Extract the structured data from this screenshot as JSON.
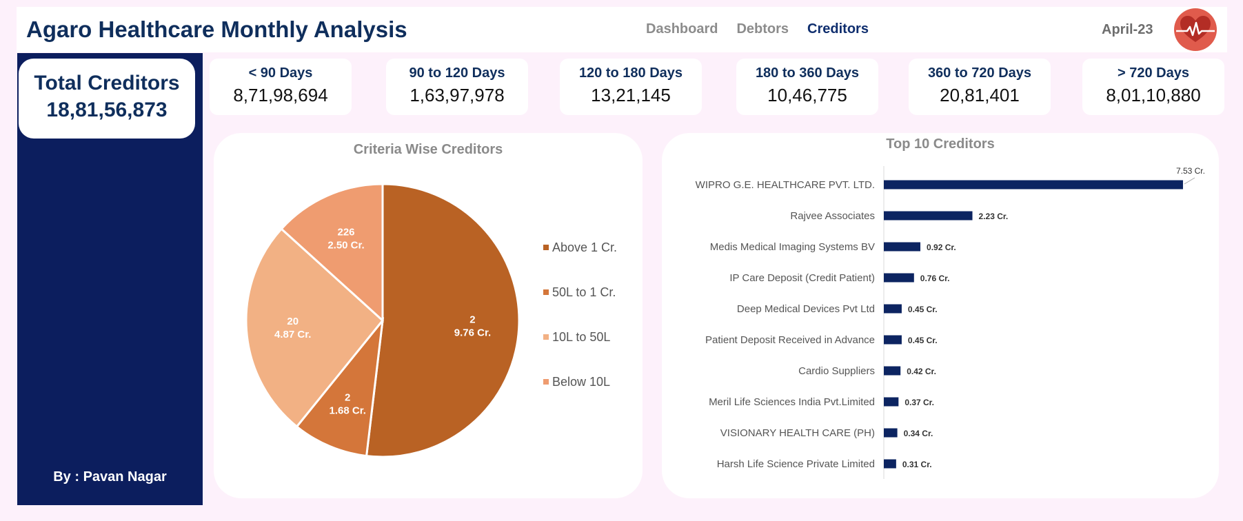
{
  "header": {
    "title": "Agaro Healthcare Monthly Analysis",
    "nav": [
      {
        "label": "Dashboard",
        "active": false
      },
      {
        "label": "Debtors",
        "active": false
      },
      {
        "label": "Creditors",
        "active": true
      }
    ],
    "period": "April-23",
    "logo_icon": "heart-pulse-icon"
  },
  "sidebar": {
    "total_label": "Total Creditors",
    "total_value": "18,81,56,873",
    "author": "By : Pavan Nagar"
  },
  "kpis": [
    {
      "label": "< 90 Days",
      "value": "8,71,98,694"
    },
    {
      "label": "90 to 120 Days",
      "value": "1,63,97,978"
    },
    {
      "label": "120 to 180 Days",
      "value": "13,21,145"
    },
    {
      "label": "180 to 360 Days",
      "value": "10,46,775"
    },
    {
      "label": "360 to 720 Days",
      "value": "20,81,401"
    },
    {
      "label": "> 720 Days",
      "value": "8,01,10,880"
    }
  ],
  "colors": {
    "navy": "#0c1e5e",
    "title_navy": "#0f2e5c",
    "bar": "#0c2461",
    "background": "#fdf1fb"
  },
  "chart_data": [
    {
      "type": "pie",
      "title": "Criteria Wise Creditors",
      "legend_position": "right",
      "slices": [
        {
          "name": "Above 1 Cr.",
          "count": "2",
          "amount": "9.76 Cr.",
          "value": 9.76,
          "color": "#b96224"
        },
        {
          "name": "50L to 1 Cr.",
          "count": "2",
          "amount": "1.68 Cr.",
          "value": 1.68,
          "color": "#d4763a"
        },
        {
          "name": "10L to 50L",
          "count": "20",
          "amount": "4.87 Cr.",
          "value": 4.87,
          "color": "#f2b184"
        },
        {
          "name": "Below 10L",
          "count": "226",
          "amount": "2.50 Cr.",
          "value": 2.5,
          "color": "#ef9c70"
        }
      ]
    },
    {
      "type": "bar",
      "orientation": "horizontal",
      "title": "Top 10 Creditors",
      "categories": [
        "WIPRO G.E. HEALTHCARE PVT. LTD.",
        "Rajvee Associates",
        "Medis Medical Imaging Systems BV",
        "IP Care Deposit (Credit Patient)",
        "Deep Medical Devices Pvt Ltd",
        "Patient Deposit Received in Advance",
        "Cardio Suppliers",
        "Meril Life Sciences India Pvt.Limited",
        "VISIONARY HEALTH CARE  (PH)",
        "Harsh Life Science Private Limited"
      ],
      "values": [
        7.53,
        2.23,
        0.92,
        0.76,
        0.45,
        0.45,
        0.42,
        0.37,
        0.34,
        0.31
      ],
      "value_labels": [
        "7.53 Cr.",
        "2.23 Cr.",
        "0.92 Cr.",
        "0.76 Cr.",
        "0.45 Cr.",
        "0.45 Cr.",
        "0.42 Cr.",
        "0.37 Cr.",
        "0.34 Cr.",
        "0.31 Cr."
      ],
      "xlim": [
        0,
        7.6
      ],
      "grid": false
    }
  ]
}
